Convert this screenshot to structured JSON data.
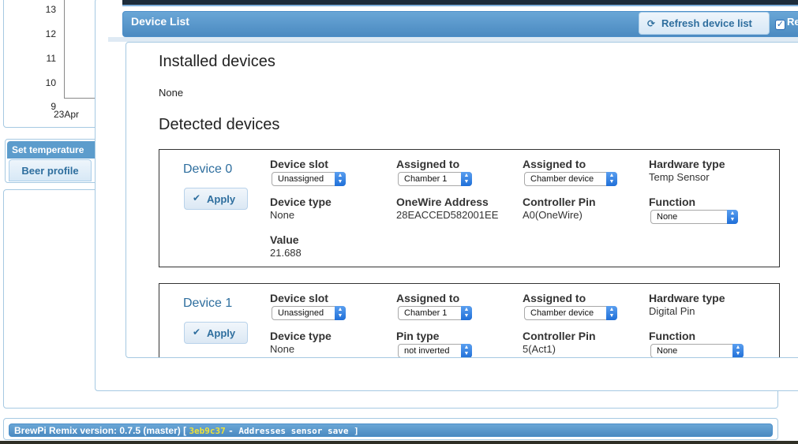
{
  "background": {
    "chart": {
      "y_ticks": [
        "13",
        "12",
        "11",
        "10",
        "9"
      ],
      "x_tick": "23Apr"
    },
    "set_temperature": {
      "header": "Set temperature",
      "tab_beer_profile": "Beer profile"
    },
    "version_bar": {
      "prefix": "BrewPi Remix version: 0.7.5 (master) [",
      "hash": "3eb9c37",
      "message": "- Addresses sensor save ]"
    }
  },
  "dialog": {
    "title": "Device List",
    "refresh_label": "Refresh device list",
    "refresh_icon": "refresh-icon",
    "auto_refresh_label": "Re",
    "auto_refresh_checked": true,
    "installed_heading": "Installed devices",
    "installed_value": "None",
    "detected_heading": "Detected devices",
    "apply_label": "Apply",
    "labels": {
      "device_slot": "Device slot",
      "assigned_to": "Assigned to",
      "hardware_type": "Hardware type",
      "device_type": "Device type",
      "onewire_address": "OneWire Address",
      "controller_pin": "Controller Pin",
      "function": "Function",
      "value": "Value",
      "pin_type": "Pin type"
    },
    "devices": [
      {
        "name": "Device 0",
        "device_slot": "Unassigned",
        "assigned_chamber": "Chamber 1",
        "assigned_device": "Chamber device",
        "hardware_type": "Temp Sensor",
        "device_type": "None",
        "onewire_address": "28EACCED582001EE",
        "controller_pin": "A0(OneWire)",
        "function": "None",
        "value": "21.688"
      },
      {
        "name": "Device 1",
        "device_slot": "Unassigned",
        "assigned_chamber": "Chamber 1",
        "assigned_device": "Chamber device",
        "hardware_type": "Digital Pin",
        "device_type": "None",
        "pin_type": "not inverted",
        "controller_pin": "5(Act1)",
        "function": "None"
      }
    ]
  }
}
